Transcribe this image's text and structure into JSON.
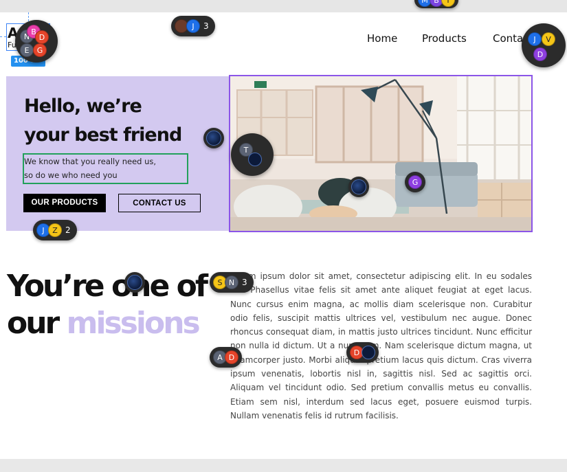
{
  "logo": {
    "text": "A",
    "sub": "Fu",
    "size_badge": "100 × 51"
  },
  "nav": {
    "items": [
      "Home",
      "Products",
      "Conta"
    ]
  },
  "hero": {
    "title_line1": "Hello, we’re",
    "title_line2": "your best friend",
    "desc_line1": "We know that you really need us,",
    "desc_line2": "so do we who need you",
    "primary_button": "OUR PRODUCTS",
    "secondary_button": "CONTACT US"
  },
  "mission": {
    "title_line1": "You’re one of",
    "title_line2_plain": "our",
    "title_line2_accent": "missions",
    "body": "Lorem ipsum dolor sit amet, consectetur adipiscing elit. In eu sodales dui. Phasellus vitae felis sit amet ante aliquet feugiat at eget lacus. Nunc cursus enim magna, ac mollis diam scelerisque non. Curabitur odio felis, suscipit mattis ultrices vel, vestibulum nec augue. Donec rhoncus consequat diam, in mattis justo ultrices tincidunt. Nunc efficitur non nulla id dictum. Ut a nunc sem. Nam scelerisque dictum magna, ut ullamcorper justo. Morbi aliquet pretium lacus quis dictum. Cras viverra ipsum venenatis, lobortis nisl in, sagittis nisl. Sed ac sagittis orci. Aliquam vel tincidunt odio. Sed pretium convallis metus eu convallis. Etiam sem nisl, interdum sed lacus eget, posuere euismod turpis. Nullam venenatis felis id rutrum facilisis."
  },
  "collaborators": {
    "top_pill": {
      "initials": [
        "M",
        "B",
        "Y"
      ]
    },
    "header_pill": {
      "initials": [
        "J"
      ],
      "count": "3"
    },
    "logo_bubble": {
      "initials": [
        "N",
        "B",
        "D",
        "E",
        "G"
      ]
    },
    "nav_bubble": {
      "initials": [
        "J",
        "V",
        "D"
      ]
    },
    "hero_bubble": {
      "initials": [
        "T"
      ]
    },
    "hero_pill": {
      "initials": [
        "J",
        "Z"
      ],
      "count": "2"
    },
    "image_marker": {
      "initials": [
        "G"
      ]
    },
    "mission_pill": {
      "initials": [
        "S",
        "N"
      ],
      "count": "3"
    },
    "mission_pill2": {
      "initials": [
        "A",
        "D"
      ]
    },
    "body_pill": {
      "initials": [
        "D"
      ]
    }
  },
  "colors": {
    "hero_bg": "#d3c9f0",
    "accent_purple": "#8b55e8",
    "accent_text": "#c9bdee",
    "selection_green": "#22a05a",
    "selection_blue": "#2491f0"
  }
}
